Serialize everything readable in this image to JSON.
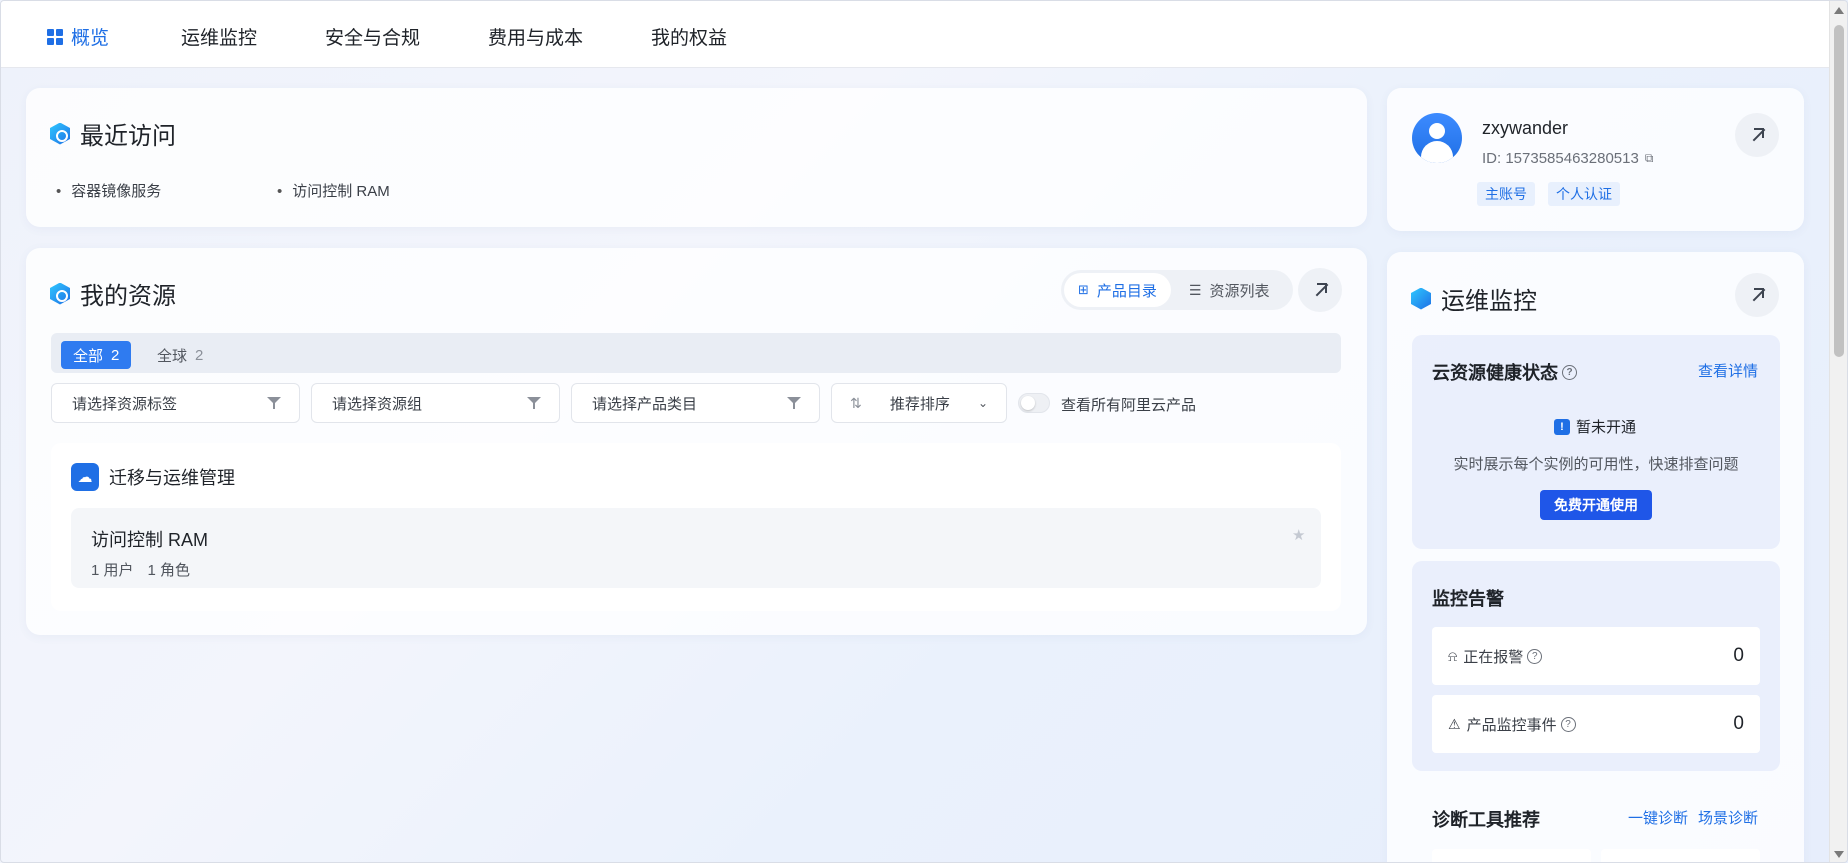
{
  "nav": {
    "items": [
      {
        "label": "概览",
        "active": true
      },
      {
        "label": "运维监控"
      },
      {
        "label": "安全与合规"
      },
      {
        "label": "费用与成本"
      },
      {
        "label": "我的权益"
      }
    ]
  },
  "recent": {
    "title": "最近访问",
    "items": [
      "容器镜像服务",
      "访问控制 RAM"
    ]
  },
  "resources": {
    "title": "我的资源",
    "view_toggle": {
      "catalog": "产品目录",
      "list": "资源列表"
    },
    "tabs": [
      {
        "label": "全部",
        "count": "2",
        "active": true
      },
      {
        "label": "全球",
        "count": "2"
      }
    ],
    "filters": {
      "tag": "请选择资源标签",
      "group": "请选择资源组",
      "category": "请选择产品类目",
      "sort": "推荐排序"
    },
    "show_all_label": "查看所有阿里云产品",
    "category_title": "迁移与运维管理",
    "product": {
      "name": "访问控制 RAM",
      "users": "1 用户",
      "roles": "1 角色"
    }
  },
  "profile": {
    "username": "zxywander",
    "id_text": "ID: 1573585463280513",
    "tags": [
      "主账号",
      "个人认证"
    ]
  },
  "ops": {
    "title": "运维监控",
    "health": {
      "title": "云资源健康状态",
      "detail_link": "查看详情",
      "status": "暂未开通",
      "desc": "实时展示每个实例的可用性，快速排查问题",
      "button": "免费开通使用"
    },
    "alerts": {
      "title": "监控告警",
      "items": [
        {
          "label": "正在报警",
          "value": "0"
        },
        {
          "label": "产品监控事件",
          "value": "0"
        }
      ]
    },
    "diagnose": {
      "title": "诊断工具推荐",
      "links": [
        "一键诊断",
        "场景诊断"
      ]
    }
  },
  "colors": {
    "accent": "#1f6fe5",
    "primary_button": "#1f56e8"
  }
}
